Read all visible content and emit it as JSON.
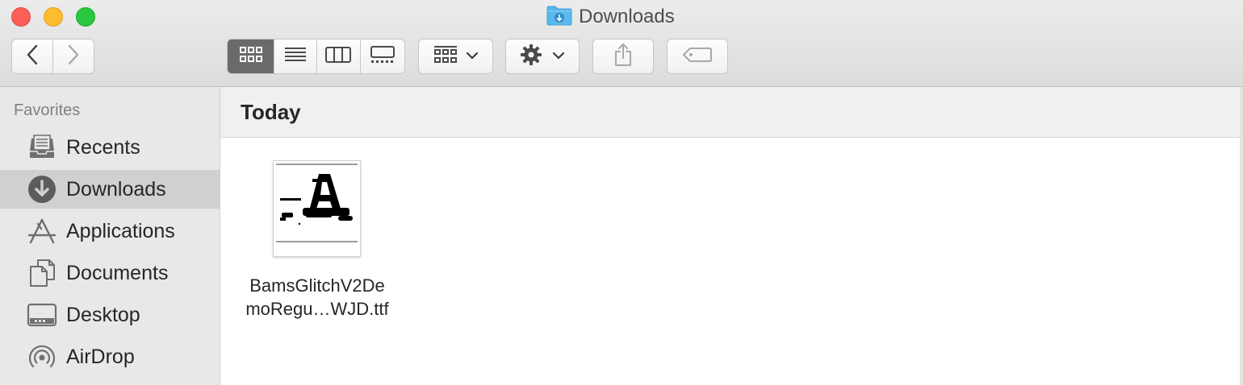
{
  "window": {
    "title": "Downloads"
  },
  "toolbar": {
    "back": "back-icon",
    "forward": "forward-icon",
    "view_modes": [
      "icon-view",
      "list-view",
      "column-view",
      "gallery-view"
    ],
    "active_view": "icon-view",
    "group_by": "group-icon",
    "action": "gear-icon",
    "share": "share-icon",
    "tags": "tag-icon"
  },
  "sidebar": {
    "heading": "Favorites",
    "items": [
      {
        "label": "Recents",
        "icon": "recents-icon",
        "selected": false
      },
      {
        "label": "Downloads",
        "icon": "downloads-icon",
        "selected": true
      },
      {
        "label": "Applications",
        "icon": "applications-icon",
        "selected": false
      },
      {
        "label": "Documents",
        "icon": "documents-icon",
        "selected": false
      },
      {
        "label": "Desktop",
        "icon": "desktop-icon",
        "selected": false
      },
      {
        "label": "AirDrop",
        "icon": "airdrop-icon",
        "selected": false
      }
    ]
  },
  "content": {
    "group_title": "Today",
    "files": [
      {
        "name_line1": "BamsGlitchV2De",
        "name_line2": "moRegu…WJD.ttf",
        "thumbnail_glyph": "A"
      }
    ]
  },
  "colors": {
    "close": "#fd5f57",
    "minimize": "#febc2e",
    "zoom": "#29c840",
    "folder_blue": "#5ab8ec",
    "active_segment": "#6a6a6a",
    "sidebar_bg": "#e8e8e8"
  }
}
